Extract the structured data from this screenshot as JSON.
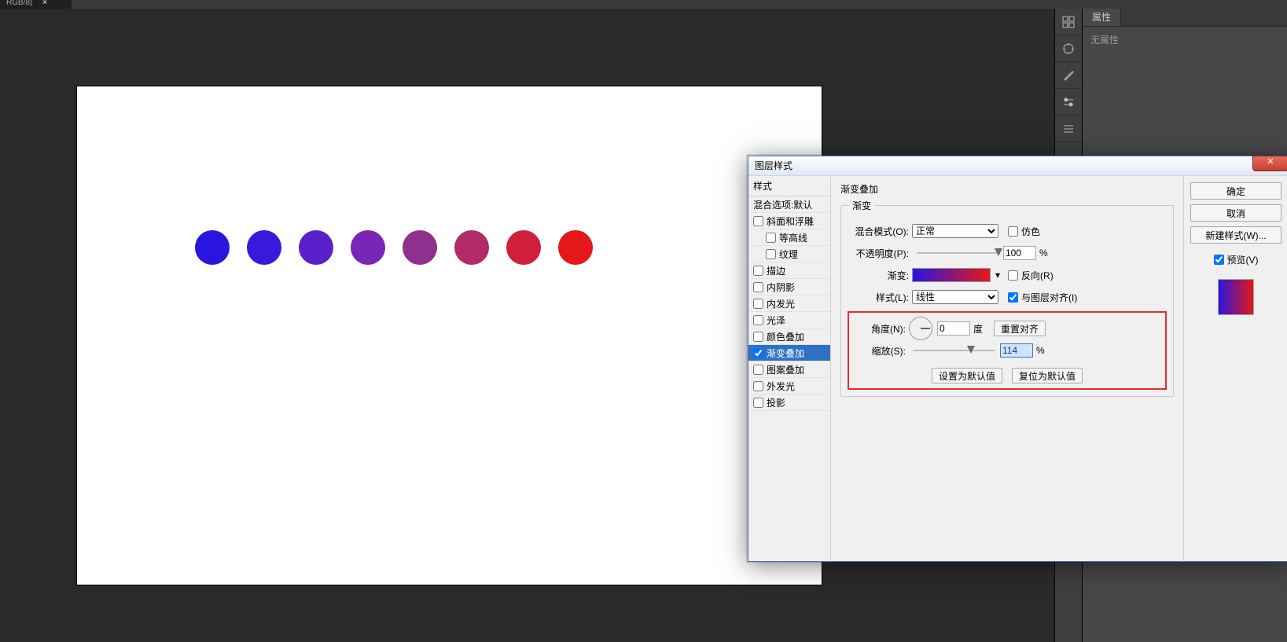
{
  "tab": {
    "label": "RGB/8)",
    "close": "×"
  },
  "canvas": {
    "dots": [
      "#2a15e0",
      "#3a18dc",
      "#5b1fca",
      "#7726b5",
      "#90308e",
      "#b22a6a",
      "#cf1f3b",
      "#e41818"
    ]
  },
  "dock_icons": [
    "grid-icon",
    "compass-icon",
    "brush-icon",
    "adjust-icon",
    "bars-icon",
    "placeholder-icon"
  ],
  "panel": {
    "tab": "属性",
    "body": "无属性"
  },
  "dialog": {
    "title": "图层样式",
    "categories": {
      "style_header": "样式",
      "blend_defaults": "混合选项:默认",
      "items": [
        {
          "label": "斜面和浮雕",
          "indent": false,
          "checked": false
        },
        {
          "label": "等高线",
          "indent": true,
          "checked": false
        },
        {
          "label": "纹理",
          "indent": true,
          "checked": false
        },
        {
          "label": "描边",
          "indent": false,
          "checked": false
        },
        {
          "label": "内阴影",
          "indent": false,
          "checked": false
        },
        {
          "label": "内发光",
          "indent": false,
          "checked": false
        },
        {
          "label": "光泽",
          "indent": false,
          "checked": false
        },
        {
          "label": "颜色叠加",
          "indent": false,
          "checked": false
        },
        {
          "label": "渐变叠加",
          "indent": false,
          "checked": true,
          "selected": true
        },
        {
          "label": "图案叠加",
          "indent": false,
          "checked": false
        },
        {
          "label": "外发光",
          "indent": false,
          "checked": false
        },
        {
          "label": "投影",
          "indent": false,
          "checked": false
        }
      ]
    },
    "opts": {
      "section_title": "渐变叠加",
      "fieldset_legend": "渐变",
      "blend_mode": {
        "label": "混合模式(O):",
        "value": "正常",
        "dither_label": "仿色"
      },
      "opacity": {
        "label": "不透明度(P):",
        "value": "100",
        "suffix": "%",
        "slider": 100
      },
      "gradient": {
        "label": "渐变:",
        "reverse_label": "反向(R)",
        "stops": [
          "#2a15e0",
          "#e41818"
        ]
      },
      "style": {
        "label": "样式(L):",
        "value": "线性",
        "align_label": "与图层对齐(I)",
        "align_checked": true
      },
      "angle": {
        "label": "角度(N):",
        "value": "0",
        "suffix": "度",
        "reset_label": "重置对齐"
      },
      "scale": {
        "label": "缩放(S):",
        "value": "114",
        "suffix": "%",
        "slider": 70
      },
      "make_default": "设置为默认值",
      "reset_default": "复位为默认值"
    },
    "buttons": {
      "ok": "确定",
      "cancel": "取消",
      "new_style": "新建样式(W)...",
      "preview_label": "预览(V)",
      "preview_checked": true,
      "preview_gradient": [
        "#2a15e0",
        "#e41818"
      ]
    }
  }
}
